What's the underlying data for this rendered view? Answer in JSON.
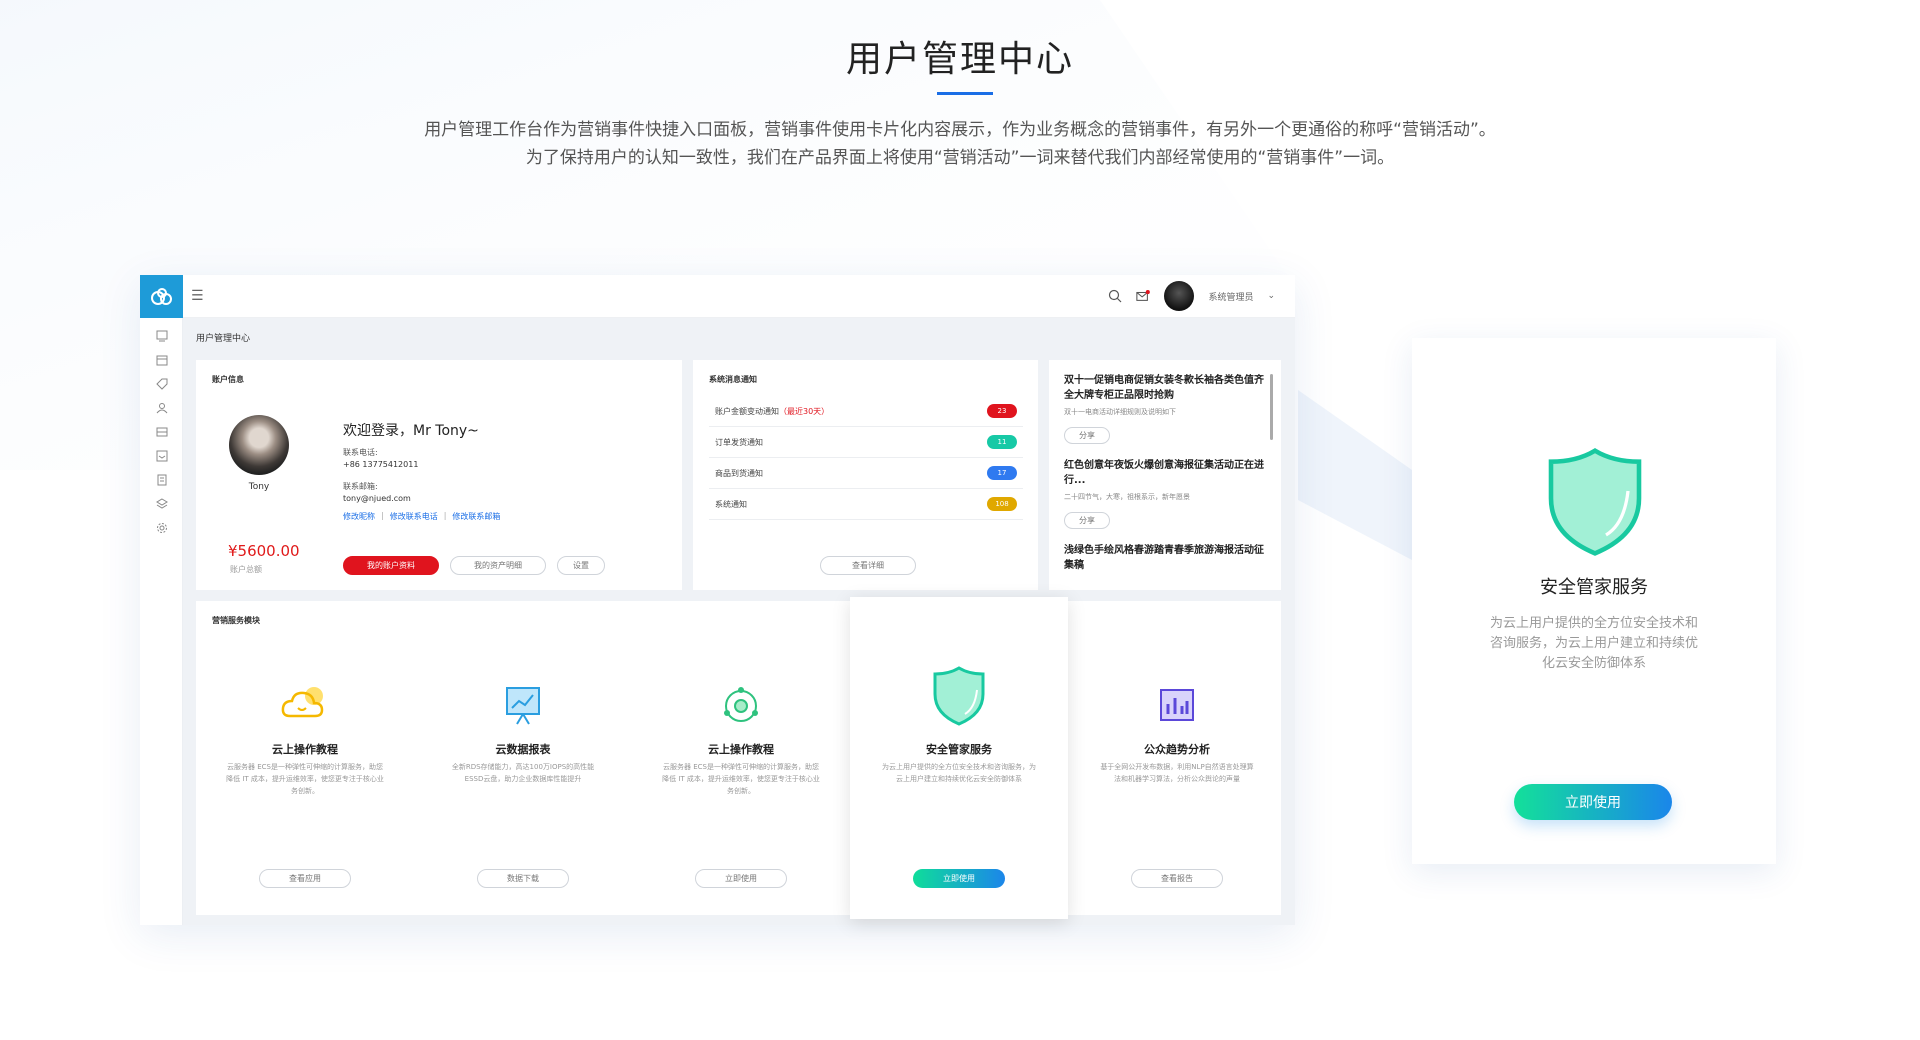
{
  "header": {
    "title": "用户管理中心",
    "desc_line1": "用户管理工作台作为营销事件快捷入口面板，营销事件使用卡片化内容展示，作为业务概念的营销事件，有另外一个更通俗的称呼“营销活动”。",
    "desc_line2": "为了保持用户的认知一致性，我们在产品界面上将使用“营销活动”一词来替代我们内部经常使用的“营销事件”一词。",
    "accent_color": "#1a6ee6"
  },
  "app": {
    "topbar": {
      "admin_name": "系统管理员"
    },
    "breadcrumb": "用户管理中心",
    "account": {
      "title": "账户信息",
      "name": "Tony",
      "welcome": "欢迎登录，Mr Tony~",
      "phone_label": "联系电话:",
      "phone": "+86 13775412011",
      "email_label": "联系邮箱:",
      "email": "tony@njued.com",
      "links": [
        "修改昵称",
        "修改联系电话",
        "修改联系邮箱"
      ],
      "balance": "¥5600.00",
      "balance_label": "账户总额",
      "buttons": [
        "我的账户资料",
        "我的资产明细",
        "设置"
      ]
    },
    "notice": {
      "title": "系统消息通知",
      "rows": [
        {
          "text": "账户金额变动通知",
          "highlight": "（最近30天）",
          "count": "23",
          "color": "#e0141e"
        },
        {
          "text": "订单发货通知",
          "highlight": "",
          "count": "11",
          "color": "#17c9a6"
        },
        {
          "text": "商品到货通知",
          "highlight": "",
          "count": "17",
          "color": "#2f7af0"
        },
        {
          "text": "系统通知",
          "highlight": "",
          "count": "108",
          "color": "#e0a800"
        }
      ],
      "button": "查看详细"
    },
    "news": {
      "items": [
        {
          "title": "双十一促销电商促销女装冬款长袖各类色值齐全大牌专柜正品限时抢购",
          "sub": "双十一电商活动详细规则及说明如下",
          "tag": "分享"
        },
        {
          "title": "红色创意年夜饭火爆创意海报征集活动正在进行...",
          "sub": "二十四节气，大寒，祖根系示，新年愿景",
          "tag": "分享"
        },
        {
          "title": "浅绿色手绘风格春游踏青春季旅游海报活动征集稿",
          "sub": "",
          "tag": ""
        }
      ]
    },
    "market": {
      "title": "营销服务模块",
      "services": [
        {
          "title": "云上操作教程",
          "desc": "云服务器 ECS是一种弹性可伸缩的计算服务，助您降低 IT 成本，提升运维效率，使您更专注于核心业务创新。",
          "button": "查看应用",
          "icon": "cloud-icon"
        },
        {
          "title": "云数据报表",
          "desc": "全新RDS存储能力，高达100万IOPS的高性能ESSD云盘，助力企业数据库性能提升",
          "button": "数据下载",
          "icon": "chart-board-icon"
        },
        {
          "title": "云上操作教程",
          "desc": "云服务器 ECS是一种弹性可伸缩的计算服务，助您降低 IT 成本，提升运维效率，使您更专注于核心业务创新。",
          "button": "立即使用",
          "icon": "network-icon"
        },
        {
          "title": "安全管家服务",
          "desc": "为云上用户提供的全方位安全技术和咨询服务，为云上用户建立和持续优化云安全防御体系",
          "button": "立即使用",
          "icon": "shield-icon"
        },
        {
          "title": "公众趋势分析",
          "desc": "基于全网公开发布数据，利用NLP自然语言处理算法和机器学习算法，分析公众舆论的声量",
          "button": "查看报告",
          "icon": "bar-chart-icon"
        }
      ]
    }
  },
  "feature_card": {
    "title": "安全管家服务",
    "desc": "为云上用户提供的全方位安全技术和咨询服务，为云上用户建立和持续优化云安全防御体系",
    "button": "立即使用",
    "icon": "shield-icon"
  }
}
